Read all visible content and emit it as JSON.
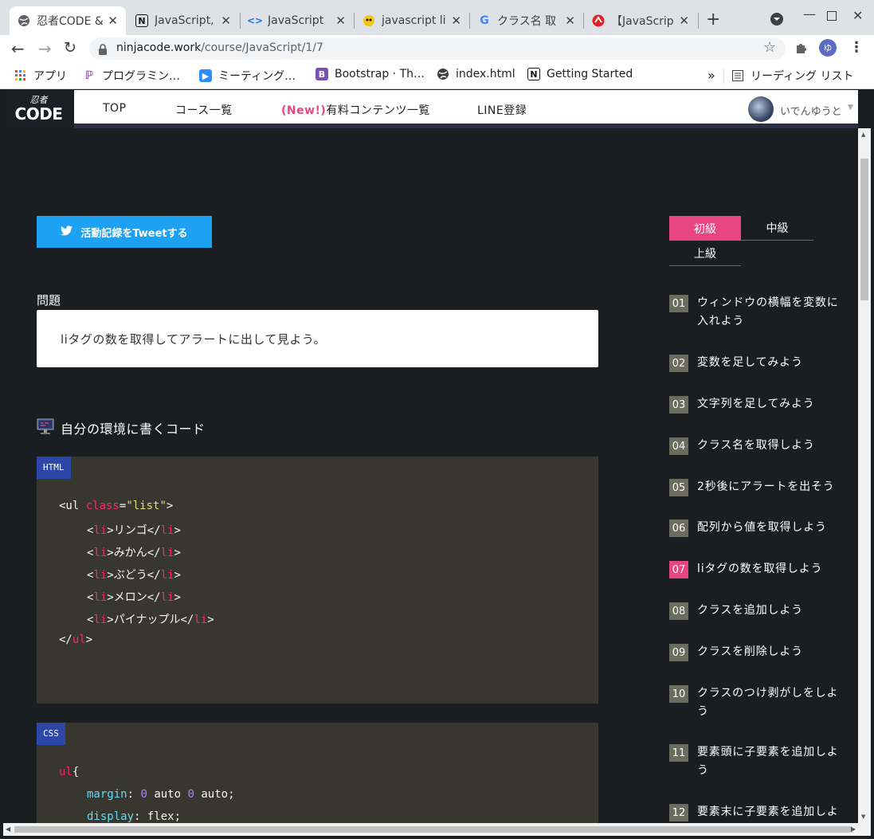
{
  "browser": {
    "tabs": [
      {
        "title": "忍者CODE &",
        "icon": "globe-icon"
      },
      {
        "title": "JavaScript,",
        "icon": "notion-icon"
      },
      {
        "title": "JavaScript",
        "icon": "code-icon"
      },
      {
        "title": "javascript li",
        "icon": "mascot-icon"
      },
      {
        "title": "クラス名 取",
        "icon": "google-icon"
      },
      {
        "title": "【JavaScrip",
        "icon": "red-logo-icon"
      }
    ],
    "url_domain": "ninjacode.work",
    "url_path": "/course/JavaScript/1/7",
    "bookmarks": [
      {
        "label": "アプリ",
        "icon": "apps-grid-icon"
      },
      {
        "label": "プログラミン…",
        "icon": "purple-logo-icon"
      },
      {
        "label": "ミーティング…",
        "icon": "zoom-icon"
      },
      {
        "label": "Bootstrap · Th…",
        "icon": "bootstrap-icon"
      },
      {
        "label": "index.html",
        "icon": "globe-icon"
      },
      {
        "label": "Getting Started",
        "icon": "notion-icon"
      }
    ],
    "more_bookmarks": "»",
    "reading_list": "リーディング リスト",
    "profile_initial": "ゆ"
  },
  "site": {
    "logo_top": "忍者",
    "logo_text": "CODE",
    "nav": {
      "top": "TOP",
      "courses": "コース一覧",
      "new_badge": "(New!)",
      "paid": "有料コンテンツ一覧",
      "line": "LINE登録"
    },
    "user_name": "いでんゆうと"
  },
  "main": {
    "tweet_button": "活動記録をTweetする",
    "question_label": "問題",
    "question_text": "liタグの数を取得してアラートに出して見よう。",
    "code_heading": "自分の環境に書くコード",
    "html_lang": "HTML",
    "css_lang": "CSS",
    "html_lines": {
      "l1_open": "<ul ",
      "l1_attr": "class",
      "l1_eq": "=",
      "l1_val": "\"list\"",
      "l1_close": ">",
      "items": [
        "リンゴ",
        "みかん",
        "ぶどう",
        "メロン",
        "パイナップル"
      ],
      "li": "li",
      "ul": "ul"
    },
    "css_lines": {
      "sel": "ul",
      "brace": "{",
      "p1": "margin",
      "v1a": "0",
      "v1b": "auto",
      "v1c": "0",
      "v1d": "auto",
      "p2": "display",
      "v2": "flex"
    }
  },
  "sidebar": {
    "levels": [
      "初級",
      "中級",
      "上級"
    ],
    "active_level": "初級",
    "lessons": [
      {
        "num": "01",
        "title": "ウィンドウの横幅を変数に入れよう"
      },
      {
        "num": "02",
        "title": "変数を足してみよう"
      },
      {
        "num": "03",
        "title": "文字列を足してみよう"
      },
      {
        "num": "04",
        "title": "クラス名を取得しよう"
      },
      {
        "num": "05",
        "title": "2秒後にアラートを出そう"
      },
      {
        "num": "06",
        "title": "配列から値を取得しよう"
      },
      {
        "num": "07",
        "title": "liタグの数を取得しよう"
      },
      {
        "num": "08",
        "title": "クラスを追加しよう"
      },
      {
        "num": "09",
        "title": "クラスを削除しよう"
      },
      {
        "num": "10",
        "title": "クラスのつけ剥がしをしよう"
      },
      {
        "num": "11",
        "title": "要素頭に子要素を追加しよう"
      },
      {
        "num": "12",
        "title": "要素末に子要素を追加しよ"
      }
    ],
    "current_lesson": "07"
  },
  "colors": {
    "accent": "#e9467f",
    "twitter": "#1da1f2",
    "code_bg": "#37372f",
    "lang_badge": "#2d47a8",
    "page_bg": "#1b1e21"
  }
}
